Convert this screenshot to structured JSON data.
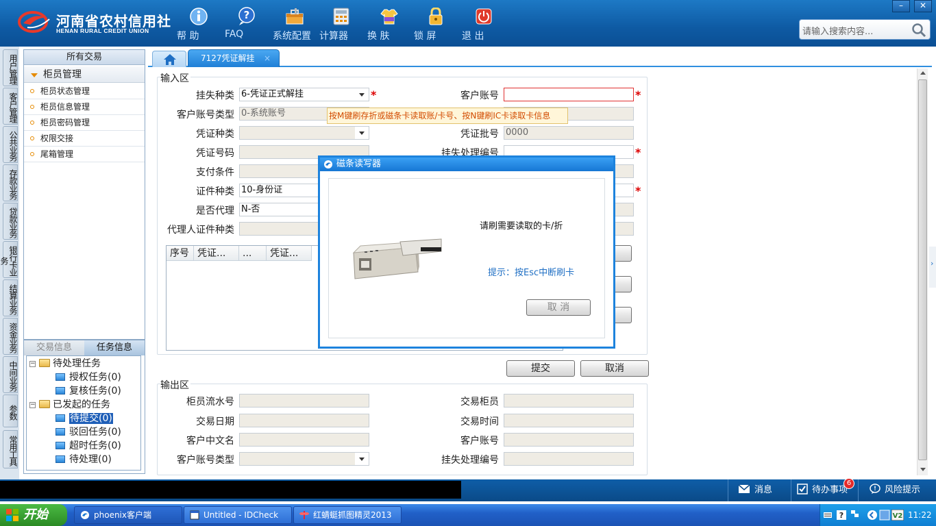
{
  "header": {
    "logo_cn": "河南省农村信用社",
    "logo_en": "HENAN RURAL CREDIT UNION",
    "toolbar": [
      {
        "label": "帮 助",
        "icon": "info-icon"
      },
      {
        "label": "FAQ",
        "icon": "help-question-icon"
      },
      {
        "label": "系统配置",
        "icon": "toolbox-icon"
      },
      {
        "label": "计算器",
        "icon": "calculator-icon"
      },
      {
        "label": "换 肤",
        "icon": "skin-shirt-icon"
      },
      {
        "label": "锁 屏",
        "icon": "lock-icon"
      },
      {
        "label": "退 出",
        "icon": "power-icon"
      }
    ],
    "search_placeholder": "请输入搜索内容...",
    "minimize": "–",
    "close": "✕"
  },
  "vtabs": [
    "用户管理",
    "客户管理",
    "公共业务",
    "存款业务",
    "贷款业务",
    "银行卡业务",
    "结算业务",
    "资金业务",
    "中间业务",
    "参数",
    "常用工具"
  ],
  "left_panel": {
    "title": "所有交易",
    "group": "柜员管理",
    "items": [
      "柜员状态管理",
      "柜员信息管理",
      "柜员密码管理",
      "权限交接",
      "尾箱管理"
    ]
  },
  "task_panel": {
    "tabs": [
      "交易信息",
      "任务信息"
    ],
    "pending_group": "待处理任务",
    "pending_items": [
      "授权任务(0)",
      "复核任务(0)"
    ],
    "initiated_group": "已发起的任务",
    "initiated_items": [
      "待提交(0)",
      "驳回任务(0)",
      "超时任务(0)",
      "待处理(0)"
    ]
  },
  "tabs": {
    "active": "7127凭证解挂",
    "close": "×"
  },
  "input_section": {
    "title": "输入区",
    "loss_type_label": "挂失种类",
    "loss_type_value": "6-凭证正式解挂",
    "cust_acct_type_label": "客户账号类型",
    "cust_acct_type_value": "0-系统账号",
    "voucher_type_label": "凭证种类",
    "voucher_no_label": "凭证号码",
    "payment_cond_label": "支付条件",
    "id_type_label": "证件种类",
    "id_type_value": "10-身份证",
    "is_agent_label": "是否代理",
    "is_agent_value": "N-否",
    "agent_id_type_label": "代理人证件种类",
    "cust_acct_label": "客户账号",
    "voucher_batch_label": "凭证批号",
    "voucher_batch_value": "0000",
    "loss_proc_no_label": "挂失处理编号",
    "required_mark": "*",
    "tooltip": "按M键刷存折或磁条卡读取账/卡号、按N键刷IC卡读取卡信息"
  },
  "grid": {
    "columns": [
      "序号",
      "凭证...",
      "...",
      "凭证..."
    ]
  },
  "buttons": {
    "submit": "提交",
    "cancel": "取消"
  },
  "output_section": {
    "title": "输出区",
    "teller_serial_label": "柜员流水号",
    "trans_date_label": "交易日期",
    "cust_cn_name_label": "客户中文名",
    "cust_acct_type_label": "客户账号类型",
    "trans_teller_label": "交易柜员",
    "trans_time_label": "交易时间",
    "cust_acct_label": "客户账号",
    "loss_proc_no_label": "挂失处理编号"
  },
  "dialog": {
    "title": "磁条读写器",
    "message": "请刷需要读取的卡/折",
    "hint": "提示：按Esc中断刷卡",
    "cancel": "取 消"
  },
  "statusbar": {
    "messages": "消息",
    "todo": "待办事项",
    "todo_count": "6",
    "risk": "风险提示"
  },
  "taskbar": {
    "start": "开始",
    "tasks": [
      "phoenix客户端",
      "Untitled - IDCheck",
      "红蜻蜓抓图精灵2013"
    ],
    "time": "11:22"
  },
  "colors": {
    "header_blue": "#0e5aa3",
    "accent_blue": "#1d83dd",
    "required_red": "#dd0000",
    "tooltip_text": "#d24b00"
  }
}
